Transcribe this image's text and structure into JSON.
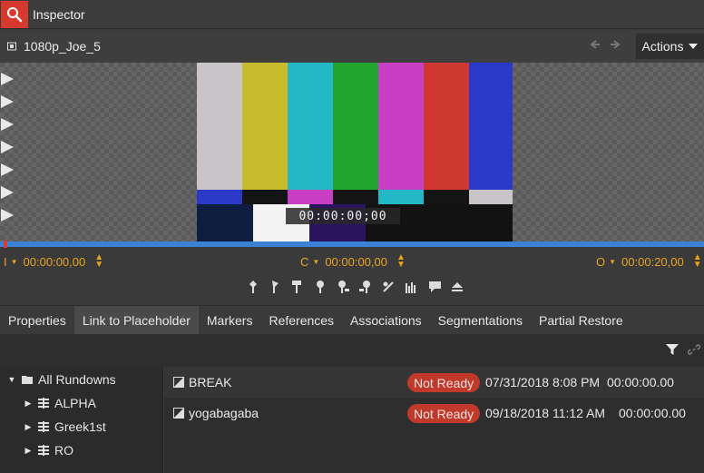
{
  "window": {
    "title": "Inspector"
  },
  "clip": {
    "name": "1080p_Joe_5"
  },
  "header": {
    "actions_label": "Actions"
  },
  "viewer": {
    "timecode": "00:00:00;00"
  },
  "timecodes": {
    "in": {
      "label": "I",
      "value": "00:00:00,00"
    },
    "current": {
      "label": "C",
      "value": "00:00:00,00"
    },
    "out": {
      "label": "O",
      "value": "00:00:20,00"
    }
  },
  "tabs": [
    {
      "label": "Properties"
    },
    {
      "label": "Link to Placeholder"
    },
    {
      "label": "Markers"
    },
    {
      "label": "References"
    },
    {
      "label": "Associations"
    },
    {
      "label": "Segmentations"
    },
    {
      "label": "Partial Restore"
    }
  ],
  "active_tab": "Link to Placeholder",
  "tree": {
    "root": "All Rundowns",
    "children": [
      "ALPHA",
      "Greek1st",
      "RO"
    ]
  },
  "placeholders": [
    {
      "name": "BREAK",
      "status": "Not Ready",
      "date": "07/31/2018 8:08 PM",
      "duration": "00:00:00.00"
    },
    {
      "name": "yogabagaba",
      "status": "Not Ready",
      "date": "09/18/2018 11:12 AM",
      "duration": "00:00:00.00"
    }
  ],
  "colors": {
    "accent": "#d63a2f",
    "timeline": "#3b82d6",
    "timecode": "#e9a323",
    "badge": "#c0392b"
  }
}
